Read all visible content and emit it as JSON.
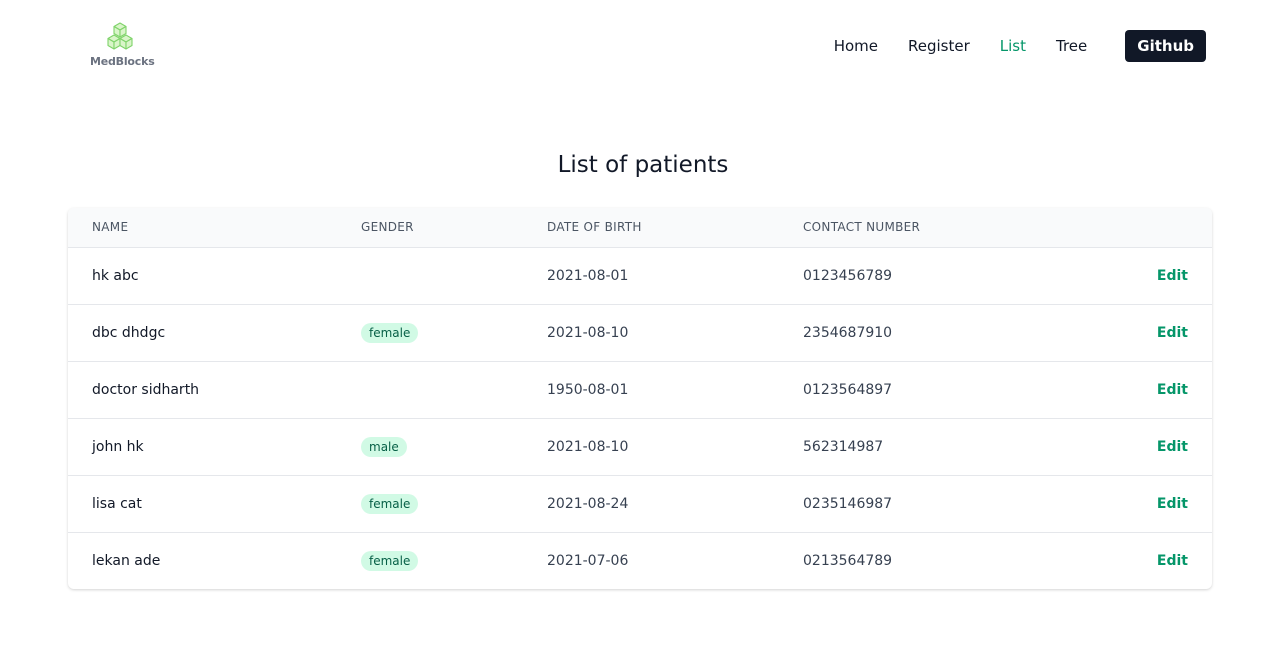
{
  "brand": {
    "name": "MedBlocks",
    "logo_icon": "cubes-icon",
    "accent_color": "#059669"
  },
  "nav": {
    "items": [
      {
        "label": "Home",
        "active": false
      },
      {
        "label": "Register",
        "active": false
      },
      {
        "label": "List",
        "active": true
      },
      {
        "label": "Tree",
        "active": false
      }
    ],
    "github_label": "Github"
  },
  "page": {
    "title": "List of patients"
  },
  "table": {
    "columns": [
      "Name",
      "Gender",
      "Date of birth",
      "Contact number",
      ""
    ],
    "edit_label": "Edit",
    "rows": [
      {
        "name": "hk abc",
        "gender": "",
        "dob": "2021-08-01",
        "contact": "0123456789"
      },
      {
        "name": "dbc dhdgc",
        "gender": "female",
        "dob": "2021-08-10",
        "contact": "2354687910"
      },
      {
        "name": "doctor sidharth",
        "gender": "",
        "dob": "1950-08-01",
        "contact": "0123564897"
      },
      {
        "name": "john hk",
        "gender": "male",
        "dob": "2021-08-10",
        "contact": "562314987"
      },
      {
        "name": "lisa cat",
        "gender": "female",
        "dob": "2021-08-24",
        "contact": "0235146987"
      },
      {
        "name": "lekan ade",
        "gender": "female",
        "dob": "2021-07-06",
        "contact": "0213564789"
      }
    ]
  }
}
